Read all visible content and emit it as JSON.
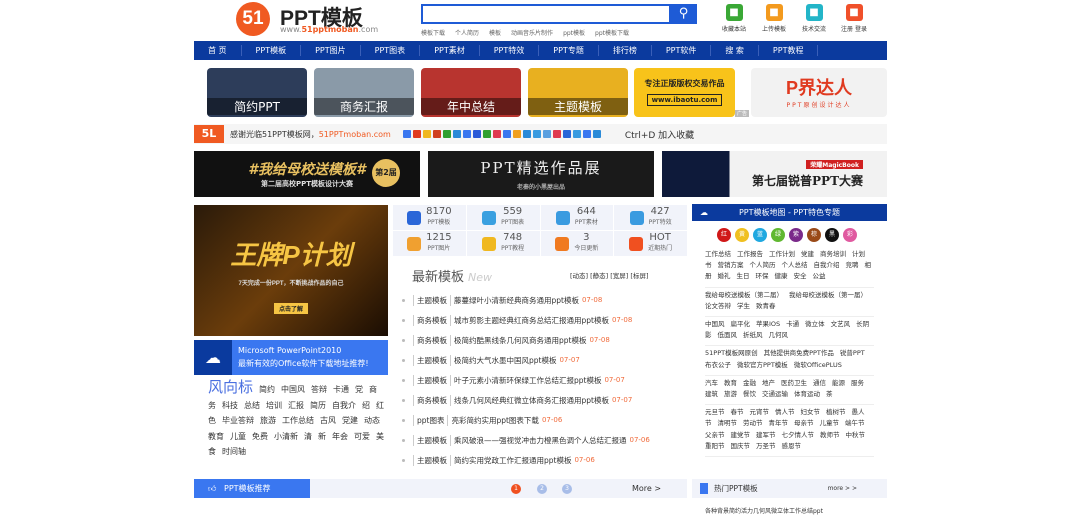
{
  "header": {
    "logo_mark": "51",
    "logo_title": "PPT模板",
    "logo_url_prefix": "www.",
    "logo_url_accent": "51pptmoban",
    "logo_url_suffix": ".com",
    "search_placeholder": "",
    "search_icon": "search-icon",
    "hot_links": [
      "模板下载",
      "个人简历",
      "模板",
      "动画音乐片制作",
      "ppt模板",
      "ppt模板下载"
    ],
    "top_icons": [
      {
        "label": "收藏本站",
        "color": "#3aa836",
        "icon": "star-icon"
      },
      {
        "label": "上传模板",
        "color": "#f39a1e",
        "icon": "upload-icon"
      },
      {
        "label": "技术交流",
        "color": "#23b5c8",
        "icon": "chat-icon"
      },
      {
        "label": "注册 登录",
        "color": "#f0502a",
        "icon": "user-icon"
      }
    ]
  },
  "nav": [
    "首 页",
    "PPT模板",
    "PPT图片",
    "PPT图表",
    "PPT素材",
    "PPT特效",
    "PPT专题",
    "排行榜",
    "PPT软件",
    "搜 索",
    "PPT教程"
  ],
  "tiles": [
    {
      "label": "简约PPT",
      "color": "#2d3d5a"
    },
    {
      "label": "商务汇报",
      "color": "#8a9aa8"
    },
    {
      "label": "年中总结",
      "color": "#b8342f"
    },
    {
      "label": "主题模板",
      "color": "#e8b020"
    }
  ],
  "ad_tile": {
    "title": "专注正版版权交易作品",
    "url": "www.ibaotu.com",
    "badge": "广告"
  },
  "brand_tile": {
    "title": "P界达人",
    "subtitle": "PPT原创设计达人"
  },
  "sharebar": {
    "logo": "5L",
    "text": "感谢光临51PPT模板网，",
    "site": "51PPTmoban.com",
    "bookmark": "Ctrl+D 加入收藏"
  },
  "big_banners": [
    {
      "title": "#我给母校送模板#",
      "subtitle": "第二届高校PPT模板设计大赛",
      "badge": "第2届"
    },
    {
      "title": "PPT精选作品展",
      "subtitle": "老秦的小黑屋出品"
    },
    {
      "title": "第七届锐普PPT大赛",
      "subtitle": "荣耀MagicBook"
    }
  ],
  "poster": {
    "title": "王牌P计划",
    "subtitle": "7天完成一份PPT，不断挑战作品的自己",
    "button": "点击了解"
  },
  "ms_bar": {
    "line1": "Microsoft PowerPoint2010",
    "line2": "最新有效的Office软件下载地址推荐!"
  },
  "tags": {
    "title": "风向标",
    "items": [
      "简约",
      "中国风",
      "答辩",
      "卡通",
      "党",
      "商务",
      "科技",
      "总结",
      "培训",
      "汇报",
      "简历",
      "自我介",
      "绍",
      "红色",
      "毕业答辩",
      "旅游",
      "工作总结",
      "古风",
      "党建",
      "动态",
      "教育",
      "儿童",
      "免费",
      "小清新",
      "清",
      "新",
      "年会",
      "可爱",
      "美食",
      "时间轴"
    ]
  },
  "stats": [
    {
      "num": "8170",
      "label": "PPT模板",
      "color": "#2a66d8",
      "icon": "ppt-icon"
    },
    {
      "num": "559",
      "label": "PPT图表",
      "color": "#3aa0e0",
      "icon": "pie-icon"
    },
    {
      "num": "644",
      "label": "PPT素材",
      "color": "#3a9be0",
      "icon": "tools-icon"
    },
    {
      "num": "427",
      "label": "PPT特效",
      "color": "#3a9be0",
      "icon": "spinner-icon"
    },
    {
      "num": "1215",
      "label": "PPT图片",
      "color": "#f0a030",
      "icon": "image-icon"
    },
    {
      "num": "748",
      "label": "PPT教程",
      "color": "#f0b820",
      "icon": "book-icon"
    },
    {
      "num": "3",
      "label": "今日更新",
      "color": "#f07a20",
      "icon": "refresh-icon"
    },
    {
      "num": "HOT",
      "label": "近期热门",
      "color": "#f05020",
      "icon": "hot-icon"
    }
  ],
  "latest": {
    "title": "最新模板",
    "title_en": "New",
    "filters": "[动态] [静态] [宽屏] [标屏]",
    "items": [
      {
        "cat": "主题模板",
        "title": "藤蔓绿叶小清新经典商务通用ppt模板",
        "date": "07-08"
      },
      {
        "cat": "商务模板",
        "title": "城市剪影主题经典红商务总结汇报通用ppt模板",
        "date": "07-08"
      },
      {
        "cat": "商务模板",
        "title": "极简约酷黑线条几何风商务通用ppt模板",
        "date": "07-08"
      },
      {
        "cat": "主题模板",
        "title": "极简约大气水墨中国风ppt模板",
        "date": "07-07"
      },
      {
        "cat": "主题模板",
        "title": "叶子元素小清新环保绿工作总结汇报ppt模板",
        "date": "07-07"
      },
      {
        "cat": "商务模板",
        "title": "线条几何风经典红微立体商务汇报通用ppt模板",
        "date": "07-07"
      },
      {
        "cat": "ppt图表",
        "title": "亮彩简约实用ppt图表下载",
        "date": "07-06"
      },
      {
        "cat": "主题模板",
        "title": "乘风破浪——强视觉冲击力橙黑色调个人总结汇报通",
        "date": "07-06"
      },
      {
        "cat": "主题模板",
        "title": "简约实用党政工作汇报通用ppt模板",
        "date": "07-06"
      }
    ]
  },
  "right": {
    "title": "PPT模板地图 - PPT特色专题",
    "colors": [
      {
        "label": "红",
        "hex": "#d01818"
      },
      {
        "label": "黄",
        "hex": "#f0c020"
      },
      {
        "label": "蓝",
        "hex": "#20a8e0"
      },
      {
        "label": "绿",
        "hex": "#60b830"
      },
      {
        "label": "紫",
        "hex": "#7a2a8a"
      },
      {
        "label": "棕",
        "hex": "#9a4a18"
      },
      {
        "label": "黑",
        "hex": "#111111"
      },
      {
        "label": "彩",
        "hex": "#e05aa0"
      }
    ],
    "groups": [
      [
        "工作总结",
        "工作报告",
        "工作计划",
        "党建",
        "商务培训",
        "计划书",
        "营销方案",
        "个人简历",
        "个人总结",
        "自我介绍",
        "竞聘",
        "相册",
        "婚礼",
        "生日",
        "环保",
        "健康",
        "安全",
        "公益"
      ],
      [
        "我给母校送模板（第二届）",
        "我给母校送模板（第一届）",
        "论文答辩",
        "学生",
        "致青春"
      ],
      [
        "中国风",
        "扁平化",
        "苹果IOS",
        "卡通",
        "微立体",
        "文艺风",
        "长阴影",
        "低面风",
        "折纸风",
        "几何风"
      ],
      [
        "51PPT模板网原创",
        "其他提供商免费PPT作品",
        "锐普PPT",
        "布衣公子",
        "微软官方PPT模板",
        "微软OfficePLUS"
      ],
      [
        "汽车",
        "教育",
        "金融",
        "地产",
        "医药卫生",
        "通信",
        "能源",
        "服务",
        "建筑",
        "旅游",
        "餐饮",
        "交通运输",
        "体育运动",
        "茶"
      ],
      [
        "元旦节",
        "春节",
        "元宵节",
        "情人节",
        "妇女节",
        "植树节",
        "愚人节",
        "清明节",
        "劳动节",
        "青年节",
        "母亲节",
        "儿童节",
        "端午节",
        "父亲节",
        "建党节",
        "建军节",
        "七夕情人节",
        "教师节",
        "中秋节",
        "重阳节",
        "国庆节",
        "万圣节",
        "感恩节"
      ]
    ]
  },
  "bottom": {
    "rec_label": "PPT模板推荐",
    "pages": [
      "1",
      "2",
      "3"
    ],
    "more": "More >",
    "hot_title": "热门PPT模板",
    "hot_more": "more > >",
    "hot_item": "各种背景简约活力几何风微立体工作总结ppt"
  }
}
